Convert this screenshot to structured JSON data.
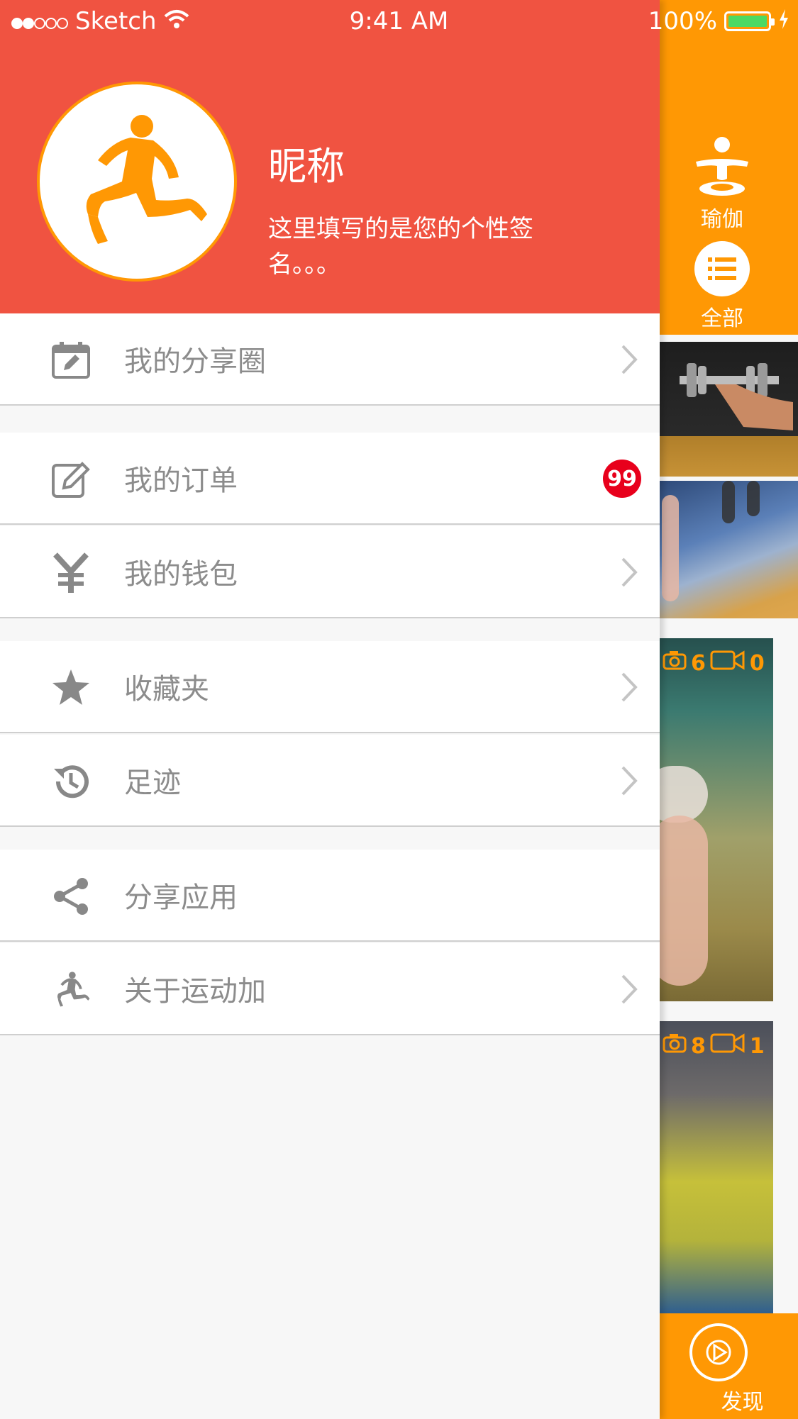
{
  "status_bar": {
    "carrier": "Sketch",
    "time": "9:41 AM",
    "battery": "100%"
  },
  "profile": {
    "nickname": "昵称",
    "signature": "这里填写的是您的个性签名。。。"
  },
  "menu": [
    {
      "label": "我的分享圈",
      "icon": "calendar-edit-icon"
    },
    {
      "label": "我的订单",
      "icon": "edit-icon",
      "badge": "99"
    },
    {
      "label": "我的钱包",
      "icon": "yen-icon"
    },
    {
      "label": "收藏夹",
      "icon": "star-icon"
    },
    {
      "label": "足迹",
      "icon": "history-icon"
    },
    {
      "label": "分享应用",
      "icon": "share-icon"
    },
    {
      "label": "关于运动加",
      "icon": "runner-icon"
    }
  ],
  "background_app": {
    "category_yoga": "瑜伽",
    "category_all": "全部",
    "card1": {
      "photos": "6",
      "videos": "0"
    },
    "card2": {
      "photos": "8",
      "videos": "1"
    },
    "tab_discover": "发现"
  },
  "colors": {
    "header": "#f05341",
    "accent": "#ff9804",
    "badge": "#e8001c",
    "menu_text": "#8c8c8c"
  }
}
